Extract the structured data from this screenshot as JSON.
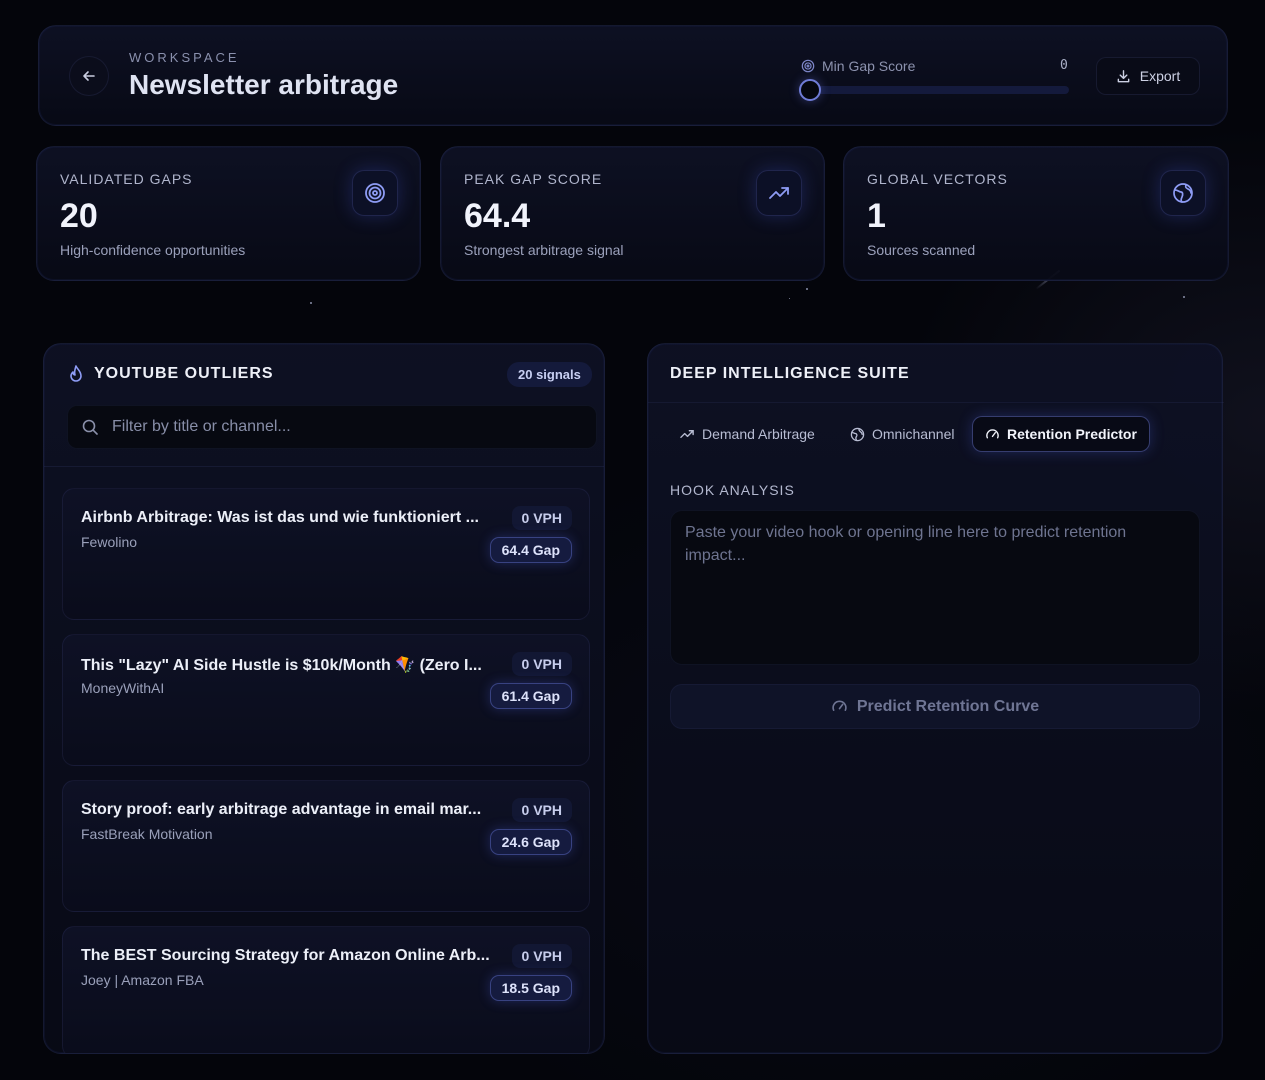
{
  "header": {
    "workspace_label": "WORKSPACE",
    "title": "Newsletter arbitrage",
    "slider_label": "Min Gap Score",
    "slider_value": "0",
    "export_label": "Export"
  },
  "stats": [
    {
      "label": "VALIDATED GAPS",
      "value": "20",
      "sub": "High-confidence opportunities",
      "icon": "target-icon"
    },
    {
      "label": "PEAK GAP SCORE",
      "value": "64.4",
      "sub": "Strongest arbitrage signal",
      "icon": "trending-up-icon"
    },
    {
      "label": "GLOBAL VECTORS",
      "value": "1",
      "sub": "Sources scanned",
      "icon": "globe-icon"
    }
  ],
  "outliers": {
    "title": "YOUTUBE OUTLIERS",
    "badge": "20 signals",
    "search_placeholder": "Filter by title or channel...",
    "items": [
      {
        "title": "Airbnb Arbitrage: Was ist das und wie funktioniert ...",
        "channel": "Fewolino",
        "vph": "0 VPH",
        "gap": "64.4 Gap"
      },
      {
        "title": "This \"Lazy\" AI Side Hustle is $10k/Month 🪁 (Zero I...",
        "channel": "MoneyWithAI",
        "vph": "0 VPH",
        "gap": "61.4 Gap"
      },
      {
        "title": "Story proof: early arbitrage advantage in email mar...",
        "channel": "FastBreak Motivation",
        "vph": "0 VPH",
        "gap": "24.6 Gap"
      },
      {
        "title": "The BEST Sourcing Strategy for Amazon Online Arb...",
        "channel": "Joey | Amazon FBA",
        "vph": "0 VPH",
        "gap": "18.5 Gap"
      }
    ]
  },
  "intel": {
    "title": "DEEP INTELLIGENCE SUITE",
    "tabs": [
      {
        "label": "Demand Arbitrage"
      },
      {
        "label": "Omnichannel"
      },
      {
        "label": "Retention Predictor"
      }
    ],
    "active_tab": "Retention Predictor",
    "hook_label": "HOOK ANALYSIS",
    "hook_placeholder": "Paste your video hook or opening line here to predict retention impact...",
    "predict_label": "Predict Retention Curve"
  },
  "colors": {
    "background": "#04050b",
    "accent": "#8e9cf5",
    "panel": "#0e1124"
  }
}
